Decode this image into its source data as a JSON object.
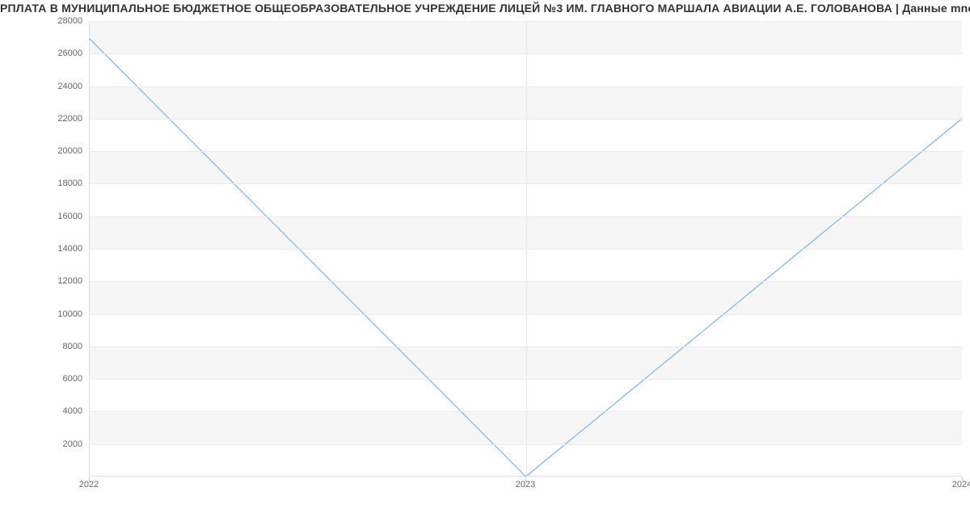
{
  "title": "РПЛАТА В МУНИЦИПАЛЬНОЕ БЮДЖЕТНОЕ ОБЩЕОБРАЗОВАТЕЛЬНОЕ УЧРЕЖДЕНИЕ ЛИЦЕЙ №3 ИМ. ГЛАВНОГО МАРШАЛА АВИАЦИИ А.Е. ГОЛОВАНОВА | Данные mnogo.wo",
  "chart_data": {
    "type": "line",
    "x": [
      "2022",
      "2023",
      "2024"
    ],
    "values": [
      26900,
      0,
      22000
    ],
    "xlabel": "",
    "ylabel": "",
    "ylim": [
      0,
      28000
    ],
    "y_ticks": [
      2000,
      4000,
      6000,
      8000,
      10000,
      12000,
      14000,
      16000,
      18000,
      20000,
      22000,
      24000,
      26000,
      28000
    ],
    "line_color": "#7cb5ec"
  }
}
